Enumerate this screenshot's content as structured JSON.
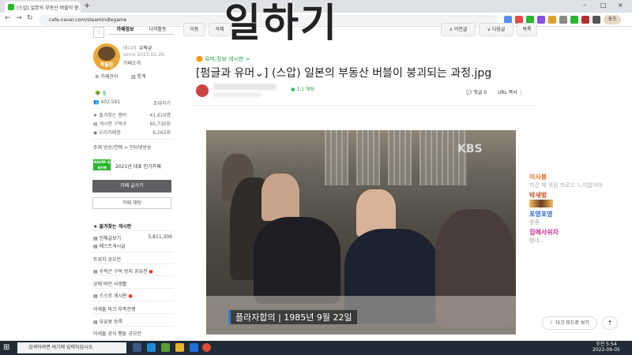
{
  "browser": {
    "tab_title": "(스압) 일본의 부동산 버블이 붕...",
    "tab_close": "×",
    "new_tab": "+",
    "url": "cafe.naver.com/steamindiegame",
    "window_controls": [
      "–",
      "□",
      "×"
    ],
    "profile_label": "포즈"
  },
  "overlay_title": "일하기",
  "sidebar": {
    "tabs": [
      "카페정보",
      "나의활동"
    ],
    "cafe_logo_text": "왁물원",
    "manager_label": "매니저",
    "manager_name": "우왁굳",
    "since": "since 2015.02.26.",
    "cafe_intro": "카페소개",
    "admin_label": "카페관리",
    "stats_label": "통계",
    "level": "숲",
    "members": "402,581",
    "invite_label": "초대하기",
    "favorite_label": "즐겨찾는 멤버",
    "favorite_count": "41,610명",
    "board_sub_label": "게시판 구독수",
    "board_sub_count": "65,730회",
    "app_members_label": "우리카페앱",
    "app_members_count": "6,263회",
    "tags": "주제 방송/연예 > 인터넷방송",
    "naver_badge": "NAVER 대표카페",
    "award": "2021년 대표 인기카페",
    "write_button": "카페 글쓰기",
    "chat_button": "카페 채팅",
    "fav_boards_title": "즐겨찾는 게시판",
    "menu": [
      {
        "label": "전체글보기",
        "count": "5,811,309"
      },
      {
        "label": "베스트게시글",
        "count": ""
      }
    ],
    "sections": [
      {
        "title": "트위치 공모전",
        "items": []
      },
      {
        "title": "수학곤 구독 방지 공유전",
        "items": []
      },
      {
        "title": "공에 버린 사생활",
        "items": []
      },
      {
        "title": "스스로 게시판",
        "items": []
      },
      {
        "title": "이세돌 마크 부족전쟁",
        "items": []
      },
      {
        "title": "부유왕 등록",
        "items": []
      },
      {
        "title": "이세돌 공식 팬툰 공모전",
        "items": []
      }
    ]
  },
  "toolbar": {
    "move": "이동",
    "delete": "삭제",
    "prev": "∧ 이전글",
    "next": "∨ 다음글",
    "list": "목록"
  },
  "article": {
    "board_link": "유머,정보 게시판 >",
    "title": "[펌글과 유머⌄] (스압) 일본의 부동산 버블이 붕괴되는 과정.jpg",
    "chat_label": "1:1 채팅",
    "comments_label": "댓글",
    "comments_count": "0",
    "url_copy": "URL 복사"
  },
  "video": {
    "watermark": "KBS",
    "caption": "플라자합의 | 1985년 9월 22일"
  },
  "chat_overlay": [
    {
      "name": "이사봉",
      "name_color": "#e8662a",
      "message": "지긴 제 위원 프로드 느끼합거야"
    },
    {
      "name": "박새벙",
      "name_color": "#c94f2a",
      "message": ""
    },
    {
      "name": "포영포영",
      "name_color": "#2a66c9",
      "message": "중중"
    },
    {
      "name": "집에서쉬자",
      "name_color": "#c92a8f",
      "message": "됐네..."
    }
  ],
  "floating": {
    "dark_mode": "다크 모드로 보기",
    "to_top": "↑"
  },
  "taskbar": {
    "search_placeholder": "검색하려면 여기에 입력하십시오.",
    "time": "오전 5:54",
    "date": "2022-09-05"
  }
}
